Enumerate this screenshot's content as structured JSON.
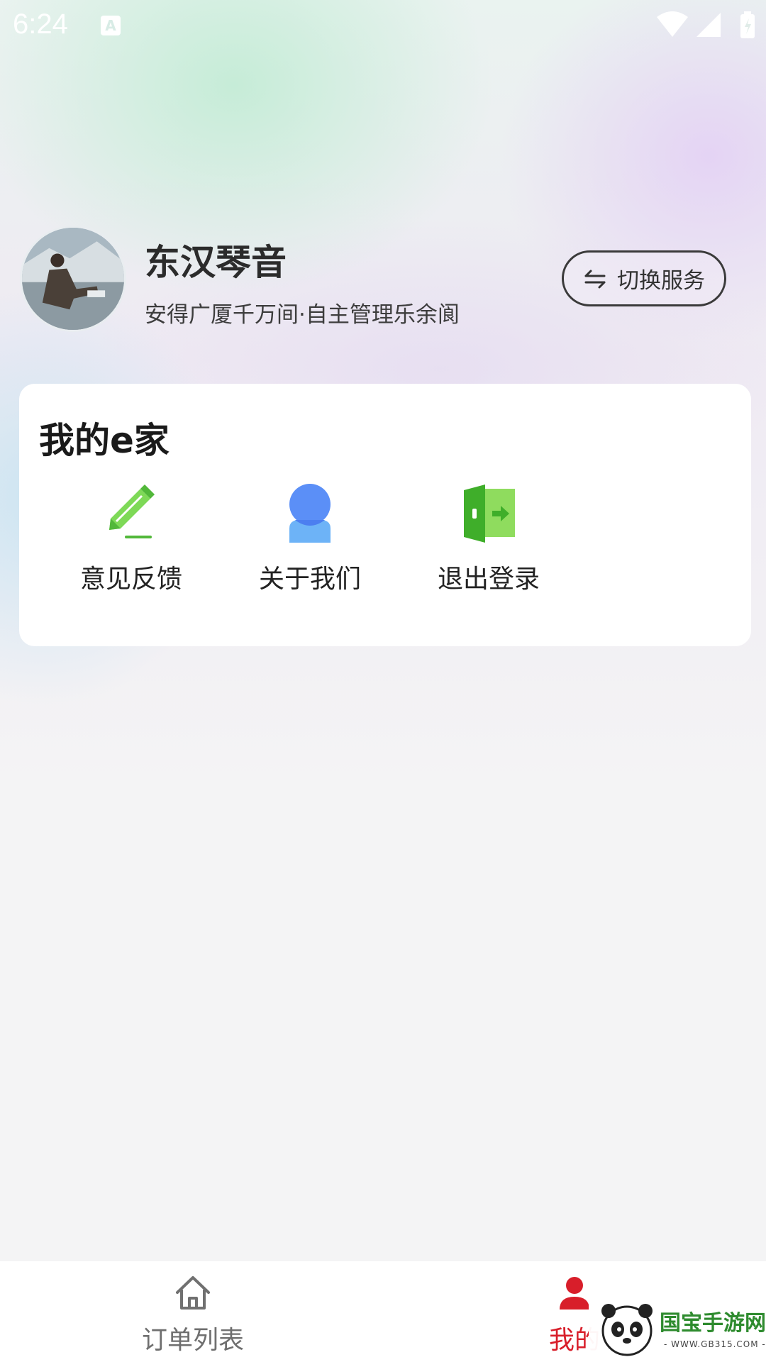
{
  "status_bar": {
    "time": "6:24",
    "notification_icon": "a-app-icon"
  },
  "profile": {
    "name": "东汉琴音",
    "motto": "安得广厦千万间·自主管理乐余阆",
    "switch_label": "切换服务"
  },
  "card": {
    "title": "我的e家",
    "items": [
      {
        "label": "意见反馈",
        "icon": "pencil-icon"
      },
      {
        "label": "关于我们",
        "icon": "user-icon"
      },
      {
        "label": "退出登录",
        "icon": "logout-door-icon"
      }
    ]
  },
  "bottom_nav": {
    "items": [
      {
        "label": "订单列表",
        "icon": "home-icon",
        "active": false
      },
      {
        "label": "我的",
        "icon": "user-icon",
        "active": true
      }
    ],
    "active_color": "#d81e2a",
    "inactive_color": "#6f6f6f"
  },
  "watermark": {
    "text": "国宝手游网",
    "sub": "- WWW.GB315.COM -"
  }
}
